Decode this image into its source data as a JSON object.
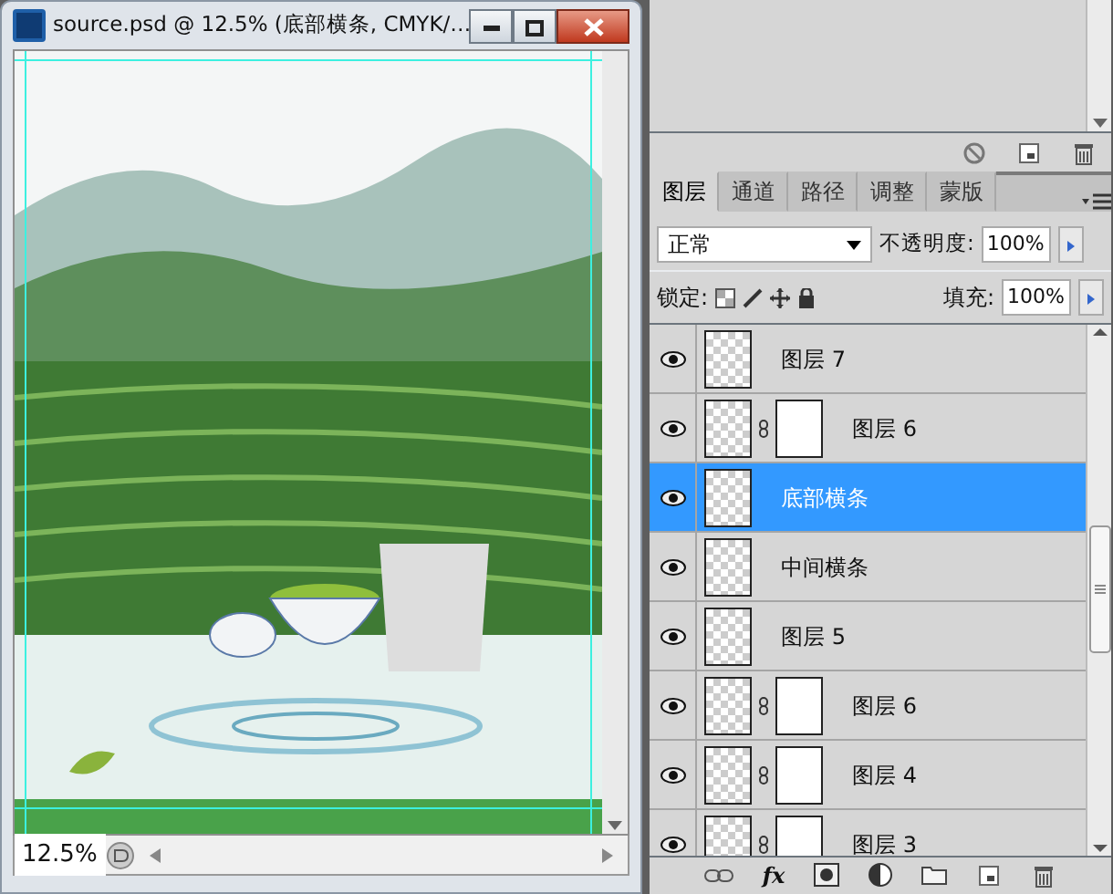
{
  "document": {
    "title": "source.psd @ 12.5% (底部横条, CMYK/…",
    "zoom": "12.5%"
  },
  "layers_panel": {
    "tabs": [
      {
        "label": "图层",
        "selected": true
      },
      {
        "label": "通道",
        "selected": false
      },
      {
        "label": "路径",
        "selected": false
      },
      {
        "label": "调整",
        "selected": false
      },
      {
        "label": "蒙版",
        "selected": false
      }
    ],
    "blend_mode": "正常",
    "opacity_label": "不透明度:",
    "opacity": "100%",
    "lock_label": "锁定:",
    "fill_label": "填充:",
    "fill": "100%",
    "layers": [
      {
        "name": "图层 7",
        "visible": true,
        "mask": false,
        "selected": false
      },
      {
        "name": "图层 6",
        "visible": true,
        "mask": true,
        "selected": false
      },
      {
        "name": "底部横条",
        "visible": true,
        "mask": false,
        "selected": true
      },
      {
        "name": "中间横条",
        "visible": true,
        "mask": false,
        "selected": false
      },
      {
        "name": "图层 5",
        "visible": true,
        "mask": false,
        "selected": false
      },
      {
        "name": "图层 6",
        "visible": true,
        "mask": true,
        "selected": false
      },
      {
        "name": "图层 4",
        "visible": true,
        "mask": true,
        "selected": false
      },
      {
        "name": "图层 3",
        "visible": true,
        "mask": true,
        "selected": false
      }
    ],
    "fx_label": "fx"
  }
}
